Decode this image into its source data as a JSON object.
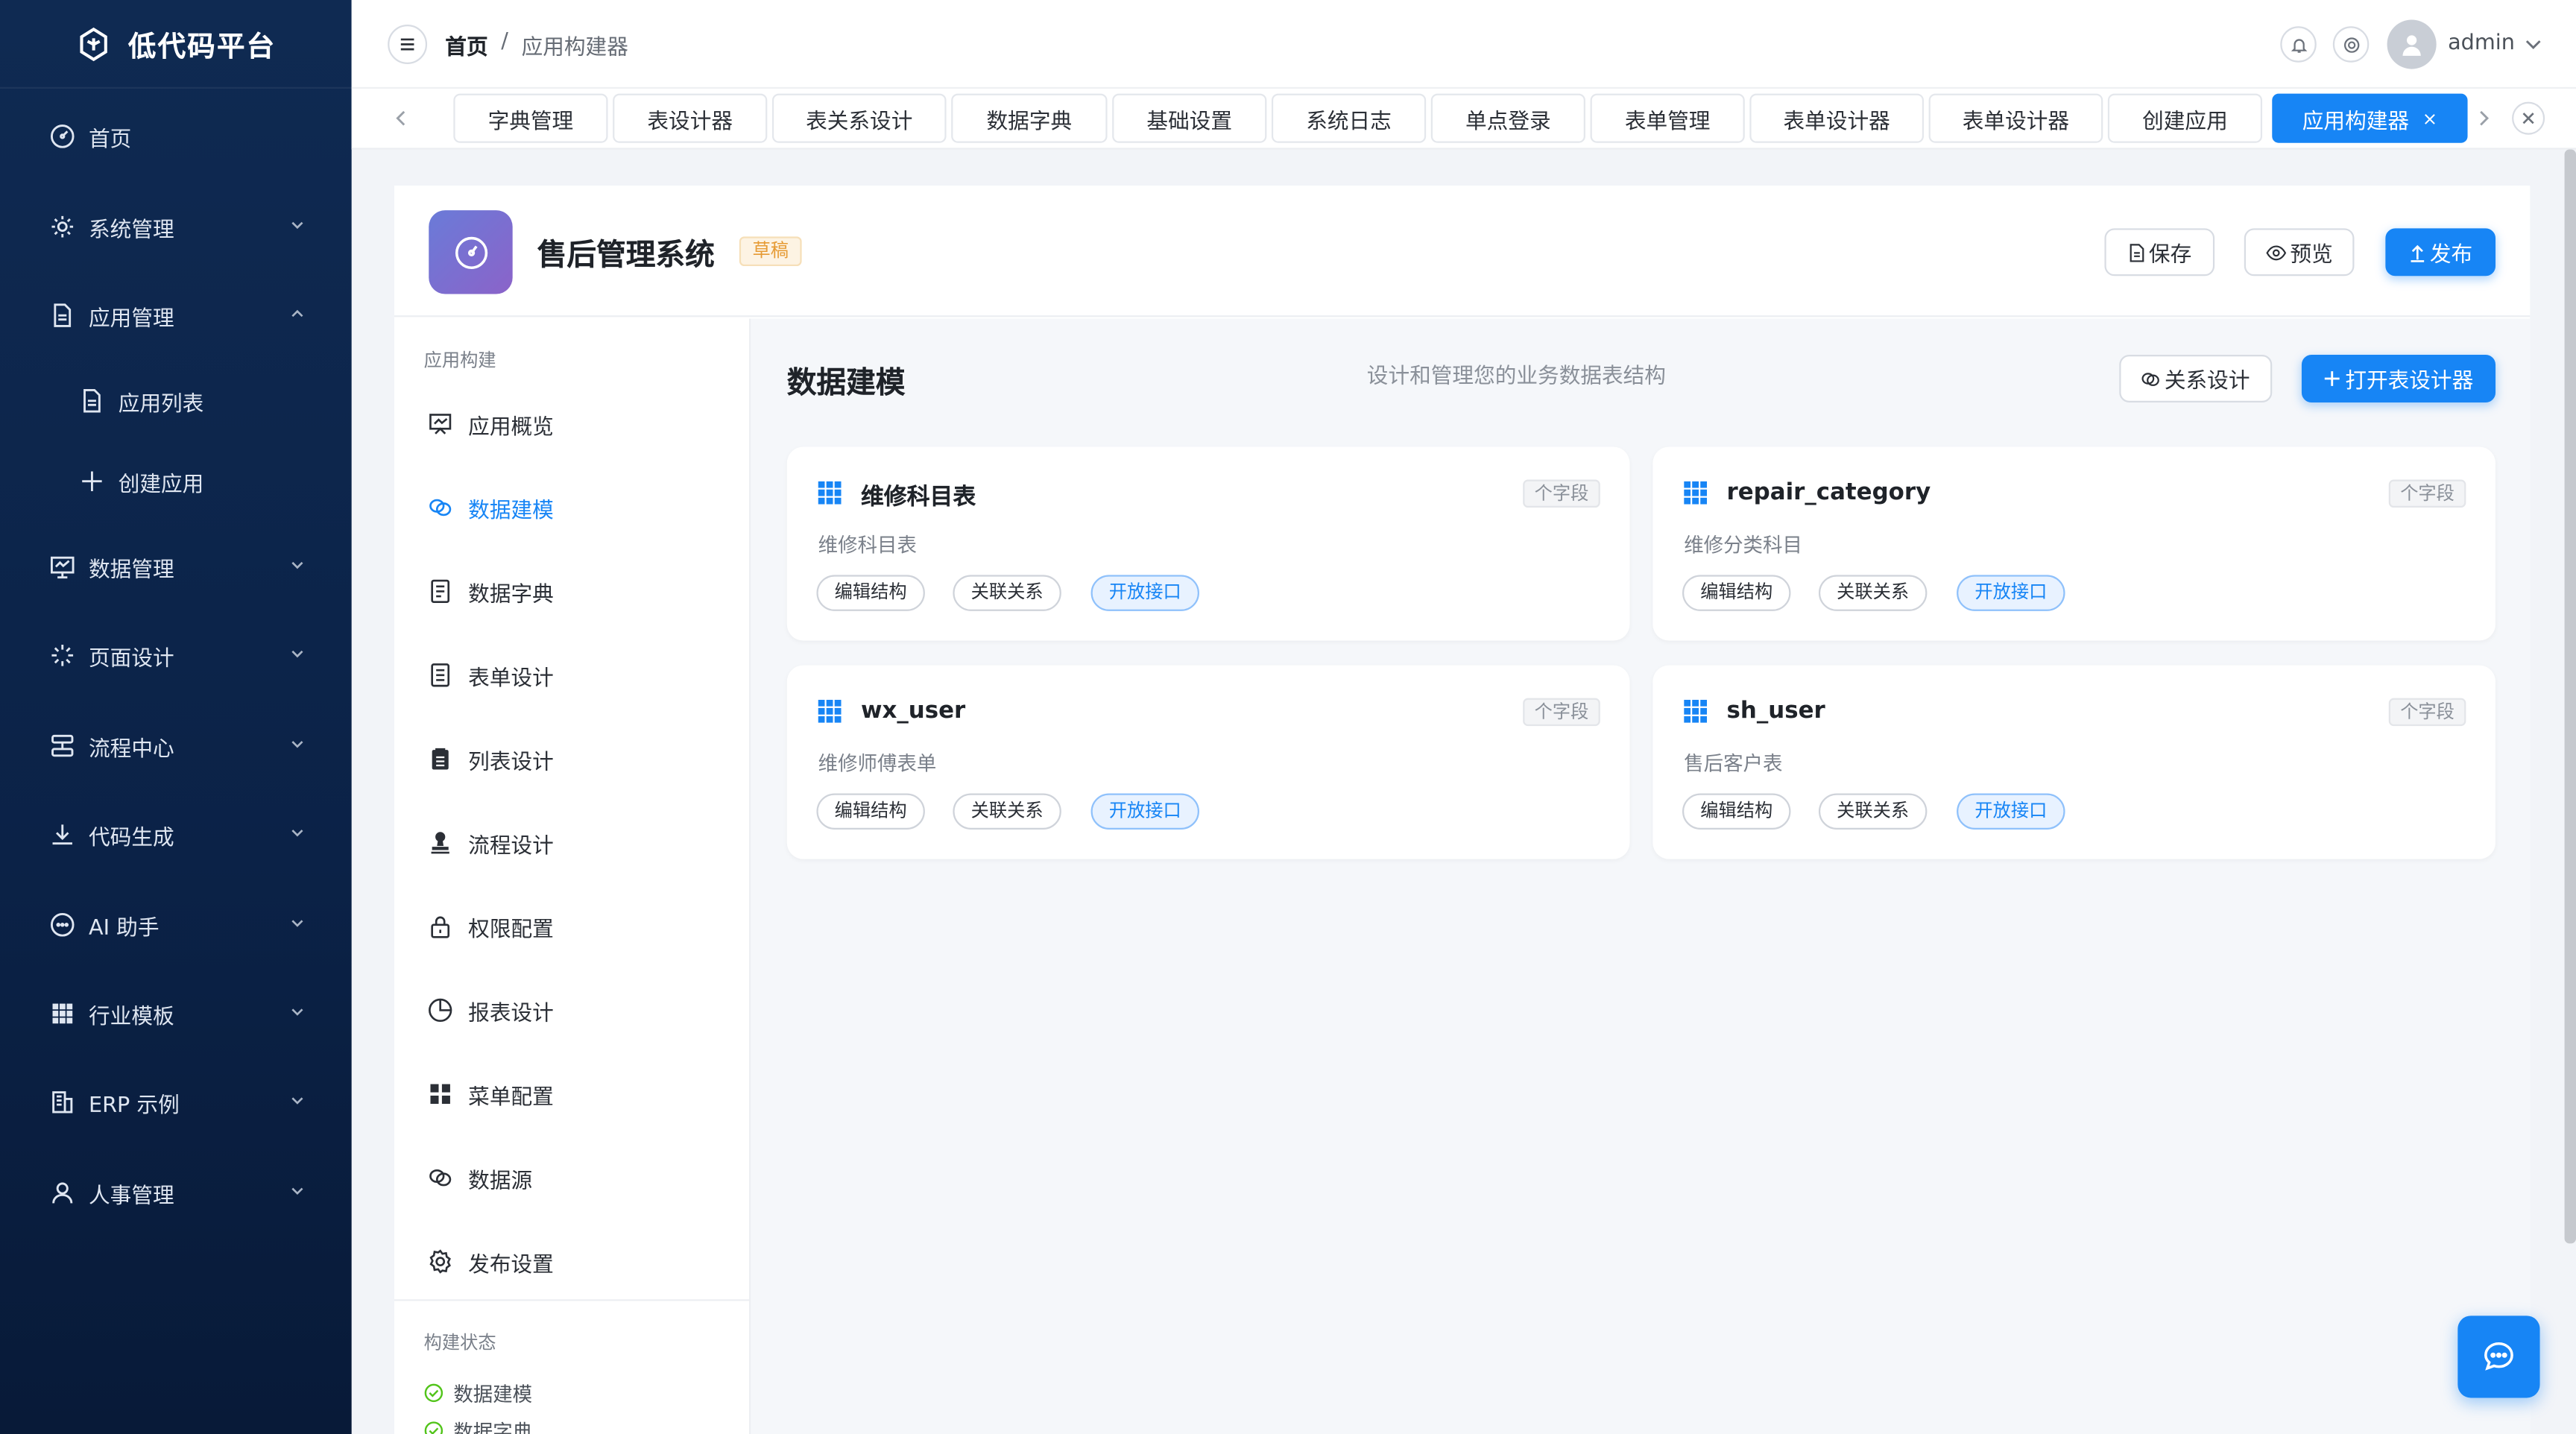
{
  "sidebar": {
    "brand": "低代码平台",
    "items": [
      {
        "label": "首页",
        "icon": "dashboard-icon"
      },
      {
        "label": "系统管理",
        "icon": "gear-icon"
      },
      {
        "label": "应用管理",
        "icon": "document-icon"
      },
      {
        "label": "应用列表",
        "icon": "document-icon"
      },
      {
        "label": "创建应用",
        "icon": "plus-icon"
      },
      {
        "label": "数据管理",
        "icon": "monitor-icon"
      },
      {
        "label": "页面设计",
        "icon": "sparkle-icon"
      },
      {
        "label": "流程中心",
        "icon": "flow-icon"
      },
      {
        "label": "代码生成",
        "icon": "download-icon"
      },
      {
        "label": "AI 助手",
        "icon": "chat-icon"
      },
      {
        "label": "行业模板",
        "icon": "grid-icon"
      },
      {
        "label": "ERP 示例",
        "icon": "building-icon"
      },
      {
        "label": "人事管理",
        "icon": "user-icon"
      }
    ]
  },
  "header": {
    "breadcrumb_home": "首页",
    "breadcrumb_sep": "/",
    "breadcrumb_current": "应用构建器",
    "username": "admin"
  },
  "tabs": [
    "字典管理",
    "表设计器",
    "表关系设计",
    "数据字典",
    "基础设置",
    "系统日志",
    "单点登录",
    "表单管理",
    "表单设计器",
    "表单设计器",
    "创建应用",
    "应用构建器"
  ],
  "active_tab_close": "×",
  "app": {
    "title": "售后管理系统",
    "status": "草稿",
    "save": "保存",
    "preview": "预览",
    "publish": "发布"
  },
  "left_nav": {
    "section_title": "应用构建",
    "items": [
      "应用概览",
      "数据建模",
      "数据字典",
      "表单设计",
      "列表设计",
      "流程设计",
      "权限配置",
      "报表设计",
      "菜单配置",
      "数据源",
      "发布设置"
    ],
    "status_title": "构建状态",
    "status_items": [
      "数据建模",
      "数据字典"
    ]
  },
  "content": {
    "title": "数据建模",
    "subtitle": "设计和管理您的业务数据表结构",
    "relation_btn": "关系设计",
    "open_designer_btn": "打开表设计器",
    "field_tag": "个字段",
    "chips": [
      "编辑结构",
      "关联关系",
      "开放接口"
    ],
    "tables": [
      {
        "name": "维修科目表",
        "desc": "维修科目表"
      },
      {
        "name": "repair_category",
        "desc": "维修分类科目"
      },
      {
        "name": "wx_user",
        "desc": "维修师傅表单"
      },
      {
        "name": "sh_user",
        "desc": "售后客户表"
      }
    ]
  },
  "colors": {
    "primary": "#1785f5",
    "sidebar_bg": "#0f2a52",
    "draft": "#e69b35",
    "success": "#52c41a"
  }
}
